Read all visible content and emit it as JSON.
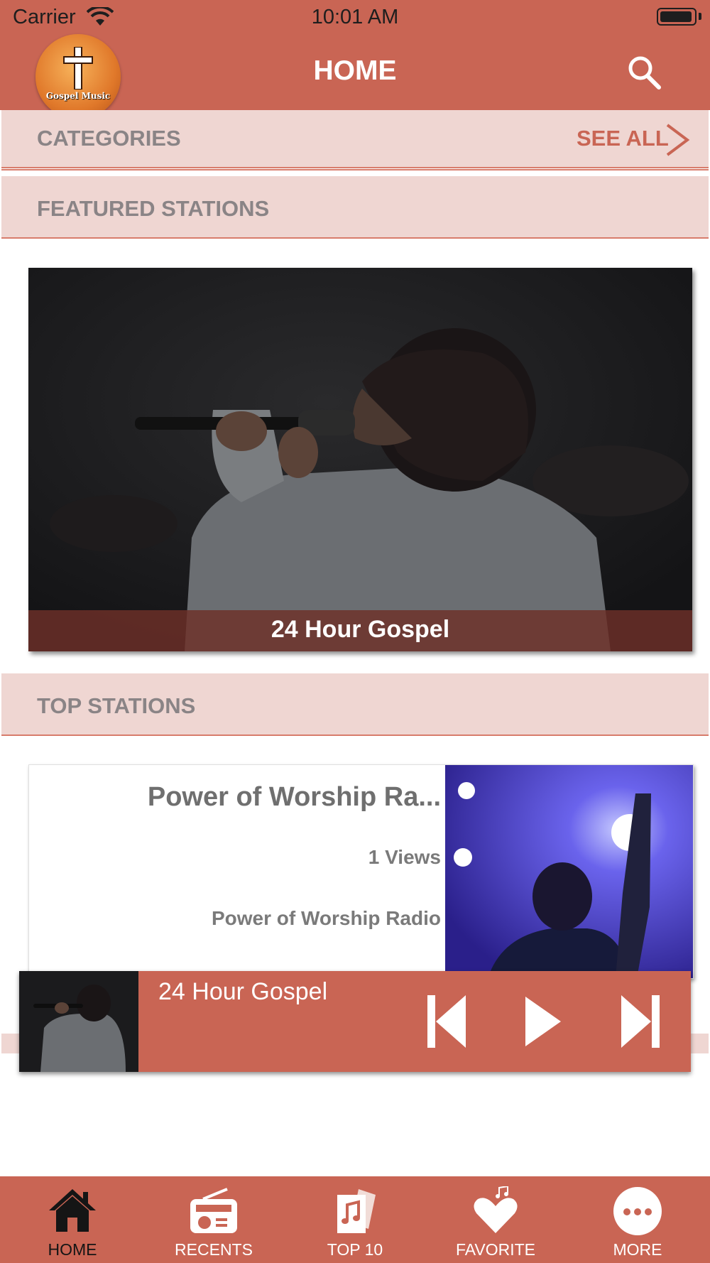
{
  "status_bar": {
    "carrier": "Carrier",
    "time": "10:01 AM"
  },
  "header": {
    "title": "HOME",
    "logo_text": "Gospel Music"
  },
  "categories": {
    "title": "CATEGORIES",
    "see_all": "SEE ALL"
  },
  "featured": {
    "title": "FEATURED STATIONS",
    "station_name": "24 Hour Gospel"
  },
  "top_stations": {
    "title": "TOP STATIONS",
    "items": [
      {
        "name": "Power of Worship Ra...",
        "views": "1 Views",
        "subtitle": "Power of Worship Radio"
      }
    ]
  },
  "player": {
    "now_playing": "24 Hour Gospel"
  },
  "tabs": [
    {
      "label": "HOME",
      "icon": "home-icon",
      "active": true
    },
    {
      "label": "RECENTS",
      "icon": "radio-icon",
      "active": false
    },
    {
      "label": "TOP 10",
      "icon": "top10-icon",
      "active": false
    },
    {
      "label": "FAVORITE",
      "icon": "heart-music-icon",
      "active": false
    },
    {
      "label": "MORE",
      "icon": "more-icon",
      "active": false
    }
  ],
  "colors": {
    "brand": "#c96554",
    "section_bg": "#efd6d2",
    "section_text": "#8a8486",
    "accent_line": "#d87c6b"
  }
}
